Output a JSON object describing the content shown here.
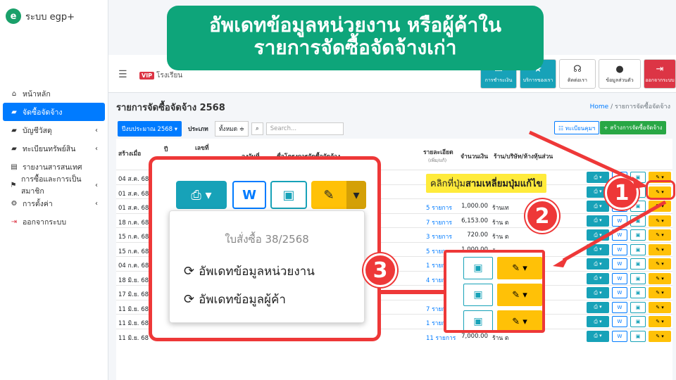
{
  "banner": {
    "line1": "อัพเดทข้อมูลหน่วยงาน หรือผู้ค้าใน",
    "line2": "รายการจัดซื้อจัดจ้างเก่า"
  },
  "brand": {
    "logo": "e",
    "name": "ระบบ egp+"
  },
  "sidebar": {
    "items": [
      {
        "icon": "home-icon",
        "glyph": "⌂",
        "label": "หน้าหลัก",
        "active": false,
        "chev": ""
      },
      {
        "icon": "folder-icon",
        "glyph": "▰",
        "label": "จัดซื้อจัดจ้าง",
        "active": true,
        "chev": ""
      },
      {
        "icon": "folder-icon",
        "glyph": "▰",
        "label": "บัญชีวัสดุ",
        "active": false,
        "chev": "‹"
      },
      {
        "icon": "folder-icon",
        "glyph": "▰",
        "label": "ทะเบียนทรัพย์สิน",
        "active": false,
        "chev": "‹"
      },
      {
        "icon": "list-icon",
        "glyph": "▤",
        "label": "รายงานสารสนเทศ",
        "active": false,
        "chev": ""
      },
      {
        "icon": "flag-icon",
        "glyph": "⚑",
        "label": "การซื้อและการเป็นสมาชิก",
        "active": false,
        "chev": "‹"
      },
      {
        "icon": "gear-icon",
        "glyph": "⚙",
        "label": "การตั้งค่า",
        "active": false,
        "chev": "‹"
      },
      {
        "icon": "logout-icon",
        "glyph": "⇥",
        "label": "ออกจากระบบ",
        "active": false,
        "chev": ""
      }
    ]
  },
  "topbar": {
    "vip": "VIP",
    "school": "โรงเรียน",
    "buttons": [
      {
        "label": "การชำระเงิน",
        "glyph": "▭",
        "bg": "#17a2b8"
      },
      {
        "label": "บริการของเรา",
        "glyph": "★",
        "bg": "#17a2b8"
      },
      {
        "label": "ติดต่อเรา",
        "glyph": "☊",
        "bg": "#ffffff"
      },
      {
        "label": "ข้อมูลส่วนตัว",
        "glyph": "●",
        "bg": "#ffffff"
      },
      {
        "label": "ออกจากระบบ",
        "glyph": "⇥",
        "bg": "#dc3545"
      }
    ]
  },
  "page": {
    "title": "รายการจัดซื้อจัดจ้าง 2568",
    "bread_home": "Home",
    "bread_sep": "/",
    "bread_current": "รายการจัดซื้อจัดจ้าง"
  },
  "filter": {
    "year": "ปีงบประมาณ 2568 ▾",
    "type_label": "ประเภท",
    "type_value": "ทั้งหมด ≑",
    "search_placeholder": "Search..."
  },
  "actions": {
    "register": "☷ ทะเบียนคุมฯ",
    "create": "+ สร้างการจัดซื้อจัดจ้าง"
  },
  "table": {
    "headers": {
      "created": "สร้างเมื่อ",
      "year": "ปี",
      "num": "เลขที่",
      "date": "ลงวันที่",
      "project": "ชื่อโครงการจัดซื้อจัดจ้าง",
      "detail": "รายละเอียด",
      "detail_sub": "(เพิ่ม/แก้)",
      "amount": "จำนวนเงิน",
      "shop": "ร้าน/บริษัท/ห้างหุ้นส่วน"
    },
    "rows": [
      {
        "date": "04 ส.ค. 68",
        "link": "",
        "amount": "",
        "shop": ""
      },
      {
        "date": "01 ส.ค. 68",
        "link": "",
        "amount": "",
        "shop": ""
      },
      {
        "date": "01 ส.ค. 68",
        "link": "5 รายการ",
        "amount": "1,000.00",
        "shop": "ร้านเท"
      },
      {
        "date": "18 ก.ค. 68",
        "link": "7 รายการ",
        "amount": "6,153.00",
        "shop": "ร้าน ต"
      },
      {
        "date": "15 ก.ค. 68",
        "link": "3 รายการ",
        "amount": "720.00",
        "shop": "ร้าน ต"
      },
      {
        "date": "15 ก.ค. 68",
        "link": "5 รายการ",
        "amount": "1,000.00",
        "shop": "ร้าน ต"
      },
      {
        "date": "04 ก.ค. 68",
        "link": "1 รายการ",
        "amount": "",
        "shop": ""
      },
      {
        "date": "18 มิ.ย. 68",
        "link": "4 รายการ",
        "amount": "",
        "shop": ""
      },
      {
        "date": "17 มิ.ย. 68",
        "link": "",
        "amount": "",
        "shop": ""
      },
      {
        "date": "11 มิ.ย. 68",
        "link": "7 รายการ",
        "amount": "",
        "shop": ""
      },
      {
        "date": "11 มิ.ย. 68",
        "link": "1 รายการ",
        "amount": "",
        "shop": ""
      },
      {
        "date": "11 มิ.ย. 68",
        "link": "11 รายการ",
        "amount": "7,000.00",
        "shop": "ร้าน ต"
      }
    ]
  },
  "row_buttons": {
    "print": "⎙ ▾",
    "word": "W",
    "box": "▣",
    "edit": "✎ ▾"
  },
  "popup": {
    "print": "⎙  ▾",
    "word": "W",
    "box": "▣",
    "edit": "✎",
    "caret": "▾",
    "menu_header": "ใบสั่งซื้อ 38/2568",
    "item1": "อัพเดทข้อมูลหน่วยงาน",
    "item2": "อัพเดทข้อมูลผู้ค้า",
    "refresh_glyph": "⟳"
  },
  "hint": {
    "pre": "คลิกที่ปุ่ม",
    "bold": "สามเหลี่ยมปุ่มแก้ไข"
  },
  "steps": {
    "s1": "1",
    "s2": "2",
    "s3": "3"
  },
  "colors": {
    "accent": "#007bff",
    "teal": "#17a2b8",
    "yellow": "#ffc107",
    "red": "#ee3838",
    "green": "#0ea57a"
  }
}
